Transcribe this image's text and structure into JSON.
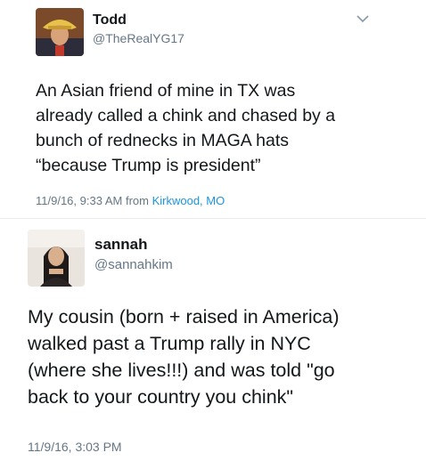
{
  "tweets": [
    {
      "name": "Todd",
      "handle": "@TheRealYG17",
      "text": "An Asian friend of mine in TX was\nalready called a chink and chased by a\nbunch of rednecks in MAGA hats\n“because Trump is president”",
      "timestamp": "11/9/16, 9:33 AM",
      "from_label": "from",
      "location": "Kirkwood, MO",
      "menu_icon": "chevron-down-icon"
    },
    {
      "name": "sannah",
      "handle": "@sannahkim",
      "text": "My cousin (born + raised in America)\nwalked past a Trump rally in NYC\n(where she lives!!!) and was told \"go\nback to your country you chink\"",
      "timestamp": "11/9/16, 3:03 PM"
    }
  ],
  "colors": {
    "text": "#14171a",
    "secondary": "#657786",
    "link": "#1b95e0",
    "divider": "#e6ecf0"
  }
}
